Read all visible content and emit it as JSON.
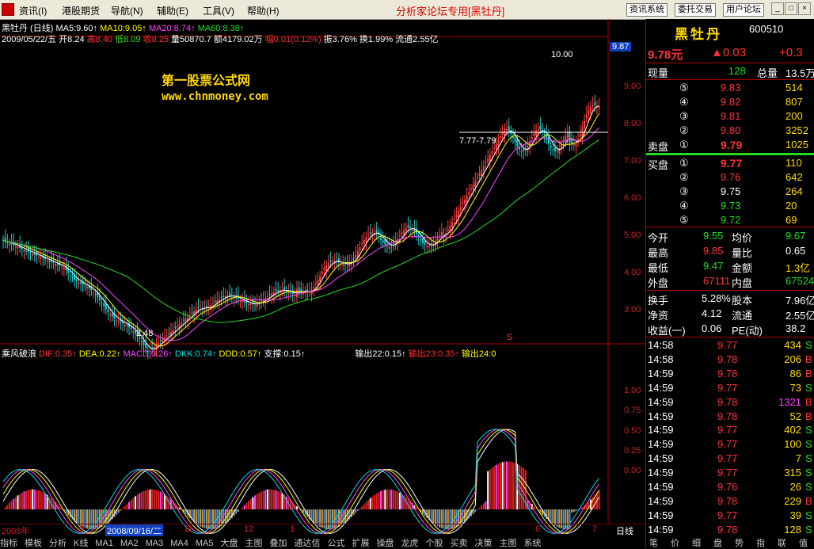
{
  "menu": {
    "items": [
      "资讯(I)",
      "港股期货",
      "导航(N)",
      "辅助(E)",
      "工具(V)",
      "帮助(H)"
    ],
    "center_title": "分析家论坛专用[黑牡丹]",
    "buttons": [
      "资讯系统",
      "委托交易",
      "用户论坛"
    ],
    "win_controls": [
      "_",
      "□",
      "×"
    ]
  },
  "chart": {
    "title_line": "黑牡丹 (日线) MA5:9.60↑ MA10:9.05↑ MA20:8.74↑ MA60:8.38↑",
    "ma": [
      {
        "label": "黑牡丹 (日线)",
        "color": "#ffffff"
      },
      {
        "label": "MA5:9.60↑",
        "color": "#ffffff"
      },
      {
        "label": "MA10:9.05↑",
        "color": "#ffff00"
      },
      {
        "label": "MA20:8.74↑",
        "color": "#ff44ff"
      },
      {
        "label": "MA60:8.38↑",
        "color": "#22dd22"
      }
    ],
    "day_info": [
      {
        "t": "2009/05/22/五 开8.24 ",
        "color": "#ffffff"
      },
      {
        "t": "高8.40 ",
        "color": "#ff3333"
      },
      {
        "t": "低8.09 ",
        "color": "#22dd22"
      },
      {
        "t": "收8.25 ",
        "color": "#ff3333"
      },
      {
        "t": "量50870.7 额4179.02万 ",
        "color": "#ffffff"
      },
      {
        "t": "幅0.01(0.12%) ",
        "color": "#ff3333"
      },
      {
        "t": "振3.76% 换1.99% 流通2.55亿",
        "color": "#ffffff"
      }
    ],
    "watermark_cn": "第一股票公式网",
    "watermark_url": "www.chnmoney.com",
    "price_badge": "9.87",
    "y_labels": [
      "9.00",
      "8.00",
      "7.00",
      "6.00",
      "5.00",
      "4.00",
      "3.00"
    ],
    "y_values": [
      9,
      8,
      7,
      6,
      5,
      4,
      3
    ],
    "ann_high": "10.00",
    "ann_low": "2.48",
    "ann_level": "7.77-7.79",
    "ann_s": "S",
    "ind_y_labels": [
      "1.00",
      "0.75",
      "0.50",
      "0.25",
      "0.00"
    ],
    "ind_y_values": [
      1.0,
      0.75,
      0.5,
      0.25,
      0.0
    ],
    "indicator": [
      {
        "t": "乘风破浪 ",
        "color": "#ffffff"
      },
      {
        "t": "DIF:0.35↑ ",
        "color": "#ff3333"
      },
      {
        "t": "DEA:0.22↑ ",
        "color": "#ffff00"
      },
      {
        "t": "MACD:0.26↑ ",
        "color": "#ff44ff"
      },
      {
        "t": "DKK:0.74↑ ",
        "color": "#00e0e0"
      },
      {
        "t": "DDD:0.57↑ ",
        "color": "#ffff00"
      },
      {
        "t": "支撑:0.15↑ ",
        "color": "#ffffff"
      },
      {
        "t": "输出22:0.15↑ ",
        "color": "#ffffff"
      },
      {
        "t": "输出23:0.35↑ ",
        "color": "#ff3333"
      },
      {
        "t": "输出24:0",
        "color": "#ffff00"
      }
    ],
    "x_labels": [
      "2008年",
      "9",
      "2008/09/16/二",
      "11",
      "12",
      "1",
      "6",
      "7"
    ],
    "period_label": "日线",
    "tabs": [
      "指标",
      "模板",
      "分析",
      "K线",
      "MA1",
      "MA2",
      "MA3",
      "MA4",
      "MA5",
      "大盘",
      "主图",
      "叠加",
      "通达信",
      "公式",
      "扩展",
      "操盘",
      "龙虎",
      "个股",
      "买卖",
      "决策",
      "主图",
      "系统"
    ]
  },
  "quote": {
    "name": "黑牡丹",
    "code": "600510",
    "price": "9.78元",
    "change": "▲0.03",
    "pct": "+0.3",
    "vol_label": "现量",
    "vol": "128",
    "total_label": "总量",
    "total": "13.5万",
    "sells": [
      {
        "lvl": "⑤",
        "price": "9.83",
        "vol": "514"
      },
      {
        "lvl": "④",
        "price": "9.82",
        "vol": "807"
      },
      {
        "lvl": "③",
        "price": "9.81",
        "vol": "200"
      },
      {
        "lvl": "②",
        "price": "9.80",
        "vol": "3252"
      },
      {
        "lvl": "①",
        "price": "9.79",
        "vol": "1025"
      }
    ],
    "sell_label": "卖盘",
    "buy_label": "买盘",
    "buys": [
      {
        "lvl": "①",
        "price": "9.77",
        "vol": "110"
      },
      {
        "lvl": "②",
        "price": "9.76",
        "vol": "642"
      },
      {
        "lvl": "③",
        "price": "9.75",
        "vol": "264"
      },
      {
        "lvl": "④",
        "price": "9.73",
        "vol": "20"
      },
      {
        "lvl": "⑤",
        "price": "9.72",
        "vol": "69"
      }
    ],
    "stats": [
      {
        "l": "今开",
        "v": "9.55",
        "vc": "#22dd22",
        "l2": "均价",
        "v2": "9.67",
        "v2c": "#22dd22"
      },
      {
        "l": "最高",
        "v": "9.85",
        "vc": "#ff3333",
        "l2": "量比",
        "v2": "0.65",
        "v2c": "#ffffff"
      },
      {
        "l": "最低",
        "v": "9.47",
        "vc": "#22dd22",
        "l2": "金额",
        "v2": "1.3亿",
        "v2c": "#ffdd00"
      },
      {
        "l": "外盘",
        "v": "67111",
        "vc": "#ff3333",
        "l2": "内盘",
        "v2": "67524",
        "v2c": "#22dd22"
      }
    ],
    "fund": [
      {
        "l": "换手",
        "v": "5.28%",
        "l2": "股本",
        "v2": "7.96亿"
      },
      {
        "l": "净资",
        "v": "4.12",
        "l2": "流通",
        "v2": "2.55亿"
      },
      {
        "l": "收益(一)",
        "v": "0.06",
        "l2": "PE(动)",
        "v2": "38.2"
      }
    ],
    "ticks": [
      {
        "t": "14:58",
        "p": "9.77",
        "pc": "#ff3333",
        "v": "434",
        "vc": "#ffdd00",
        "f": "S",
        "fc": "#22dd22"
      },
      {
        "t": "14:58",
        "p": "9.78",
        "pc": "#ff3333",
        "v": "206",
        "vc": "#ffdd00",
        "f": "B",
        "fc": "#ff3333"
      },
      {
        "t": "14:59",
        "p": "9.78",
        "pc": "#ff3333",
        "v": "86",
        "vc": "#ffdd00",
        "f": "B",
        "fc": "#ff3333"
      },
      {
        "t": "14:59",
        "p": "9.77",
        "pc": "#ff3333",
        "v": "73",
        "vc": "#ffdd00",
        "f": "S",
        "fc": "#22dd22"
      },
      {
        "t": "14:59",
        "p": "9.78",
        "pc": "#ff3333",
        "v": "1321",
        "vc": "#ff44ff",
        "f": "B",
        "fc": "#ff3333"
      },
      {
        "t": "14:59",
        "p": "9.78",
        "pc": "#ff3333",
        "v": "52",
        "vc": "#ffdd00",
        "f": "B",
        "fc": "#ff3333"
      },
      {
        "t": "14:59",
        "p": "9.77",
        "pc": "#ff3333",
        "v": "402",
        "vc": "#ffdd00",
        "f": "S",
        "fc": "#22dd22"
      },
      {
        "t": "14:59",
        "p": "9.77",
        "pc": "#ff3333",
        "v": "100",
        "vc": "#ffdd00",
        "f": "S",
        "fc": "#22dd22"
      },
      {
        "t": "14:59",
        "p": "9.77",
        "pc": "#ff3333",
        "v": "7",
        "vc": "#ffdd00",
        "f": "S",
        "fc": "#22dd22"
      },
      {
        "t": "14:59",
        "p": "9.77",
        "pc": "#ff3333",
        "v": "315",
        "vc": "#ffdd00",
        "f": "S",
        "fc": "#22dd22"
      },
      {
        "t": "14:59",
        "p": "9.76",
        "pc": "#ff3333",
        "v": "26",
        "vc": "#ffdd00",
        "f": "S",
        "fc": "#22dd22"
      },
      {
        "t": "14:59",
        "p": "9.78",
        "pc": "#ff3333",
        "v": "229",
        "vc": "#ffdd00",
        "f": "B",
        "fc": "#ff3333"
      },
      {
        "t": "14:59",
        "p": "9.77",
        "pc": "#ff3333",
        "v": "39",
        "vc": "#ffdd00",
        "f": "S",
        "fc": "#22dd22"
      },
      {
        "t": "14:59",
        "p": "9.78",
        "pc": "#ff3333",
        "v": "128",
        "vc": "#ffdd00",
        "f": "S",
        "fc": "#22dd22"
      }
    ],
    "bottom_tabs": [
      "笔",
      "价",
      "细",
      "盘",
      "势",
      "指",
      "联",
      "值"
    ]
  }
}
